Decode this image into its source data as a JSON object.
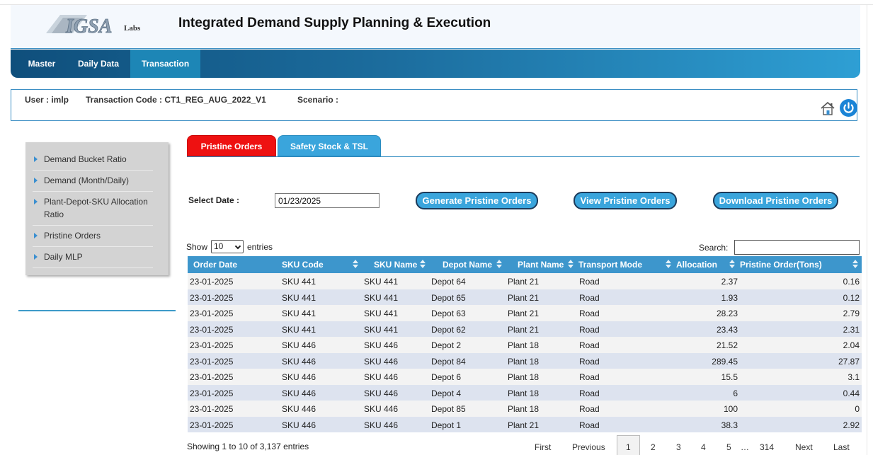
{
  "header": {
    "logo_text": "IGSA",
    "logo_sub": "Labs",
    "title": "Integrated Demand Supply Planning & Execution"
  },
  "nav": {
    "items": [
      {
        "label": "Master"
      },
      {
        "label": "Daily Data"
      },
      {
        "label": "Transaction"
      }
    ],
    "active": "Transaction"
  },
  "infobar": {
    "user": "User : imlp",
    "transaction_code": "Transaction Code : CT1_REG_AUG_2022_V1",
    "scenario": "Scenario :"
  },
  "sidebar": {
    "items": [
      {
        "label": "Demand Bucket Ratio"
      },
      {
        "label": "Demand (Month/Daily)"
      },
      {
        "label": "Plant-Depot-SKU Allocation Ratio"
      },
      {
        "label": "Pristine Orders"
      },
      {
        "label": "Daily MLP"
      }
    ]
  },
  "tabs": [
    {
      "label": "Pristine Orders",
      "active": true
    },
    {
      "label": "Safety Stock & TSL",
      "active": false
    }
  ],
  "controls": {
    "select_date_label": "Select Date :",
    "date_value": "01/23/2025",
    "generate_label": "Generate Pristine Orders",
    "view_label": "View Pristine Orders",
    "download_label": "Download Pristine Orders",
    "show_label": "Show",
    "show_value": "10",
    "entries_label": "entries",
    "search_label": "Search:"
  },
  "table": {
    "columns": [
      "Order Date",
      "SKU Code",
      "SKU Name",
      "Depot Name",
      "Plant Name",
      "Transport Mode",
      "Allocation",
      "Pristine Order(Tons)"
    ],
    "rows": [
      [
        "23-01-2025",
        "SKU 441",
        "SKU 441",
        "Depot 64",
        "Plant 21",
        "Road",
        "2.37",
        "0.16"
      ],
      [
        "23-01-2025",
        "SKU 441",
        "SKU 441",
        "Depot 65",
        "Plant 21",
        "Road",
        "1.93",
        "0.12"
      ],
      [
        "23-01-2025",
        "SKU 441",
        "SKU 441",
        "Depot 63",
        "Plant 21",
        "Road",
        "28.23",
        "2.79"
      ],
      [
        "23-01-2025",
        "SKU 441",
        "SKU 441",
        "Depot 62",
        "Plant 21",
        "Road",
        "23.43",
        "2.31"
      ],
      [
        "23-01-2025",
        "SKU 446",
        "SKU 446",
        "Depot 2",
        "Plant 18",
        "Road",
        "21.52",
        "2.04"
      ],
      [
        "23-01-2025",
        "SKU 446",
        "SKU 446",
        "Depot 84",
        "Plant 18",
        "Road",
        "289.45",
        "27.87"
      ],
      [
        "23-01-2025",
        "SKU 446",
        "SKU 446",
        "Depot 6",
        "Plant 18",
        "Road",
        "15.5",
        "3.1"
      ],
      [
        "23-01-2025",
        "SKU 446",
        "SKU 446",
        "Depot 4",
        "Plant 18",
        "Road",
        "6",
        "0.44"
      ],
      [
        "23-01-2025",
        "SKU 446",
        "SKU 446",
        "Depot 85",
        "Plant 18",
        "Road",
        "100",
        "0"
      ],
      [
        "23-01-2025",
        "SKU 446",
        "SKU 446",
        "Depot 1",
        "Plant 21",
        "Road",
        "38.3",
        "2.92"
      ]
    ]
  },
  "footer": {
    "info": "Showing 1 to 10 of 3,137 entries",
    "pagination": {
      "first": "First",
      "previous": "Previous",
      "pages": [
        "1",
        "2",
        "3",
        "4",
        "5"
      ],
      "ellipsis": "…",
      "last_page": "314",
      "next": "Next",
      "last": "Last"
    }
  },
  "colors": {
    "nav_dark": "#0f4f7c",
    "nav_light": "#2e9fd4",
    "tab_active": "#ee1111",
    "tab_inactive": "#3aa5dc",
    "table_header": "#3d96cc",
    "row_alt": "#dde3ef"
  },
  "icons": {
    "home": "home-icon",
    "power": "power-icon",
    "bullet": "triangle-bullet-icon",
    "sort": "sort-icon"
  }
}
